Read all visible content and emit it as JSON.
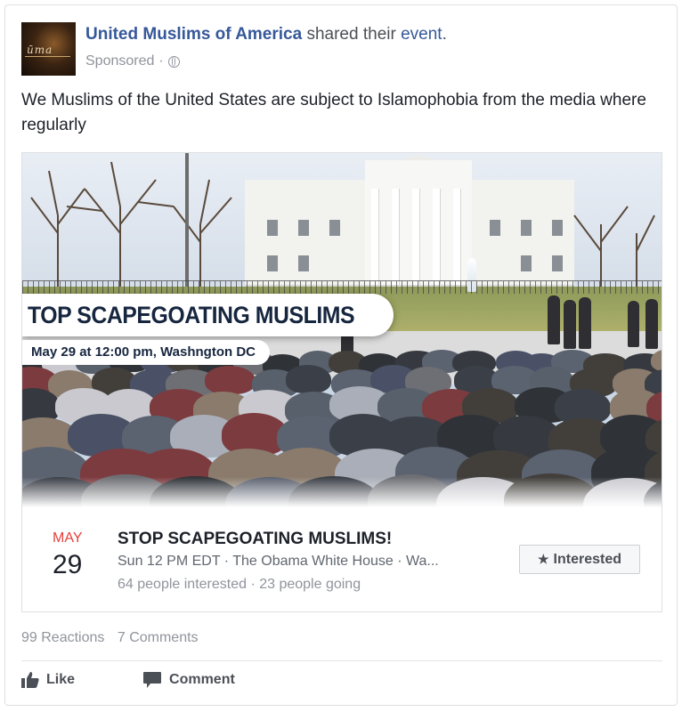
{
  "post": {
    "page_name": "United Muslims of America",
    "shared_prefix": "shared their",
    "shared_link": "event",
    "shared_suffix": ".",
    "sponsored": "Sponsored",
    "separator": "·",
    "privacy_icon": "globe-icon",
    "avatar_text": "ūma",
    "text": "We Muslims of the United States are subject to Islamophobia from the media where regularly"
  },
  "event_image": {
    "banner_title": "TOP SCAPEGOATING MUSLIMS",
    "banner_date": "May 29 at 12:00 pm, Washngton DC"
  },
  "event": {
    "month": "MAY",
    "day": "29",
    "title": "STOP SCAPEGOATING MUSLIMS!",
    "details": "Sun 12 PM EDT · The Obama White House · Wa...",
    "stats": "64 people interested · 23 people going",
    "interested_label": "Interested",
    "interested_icon": "star-icon"
  },
  "engagement": {
    "reactions": "99 Reactions",
    "comments": "7 Comments"
  },
  "actions": {
    "like_label": "Like",
    "comment_label": "Comment",
    "like_icon": "thumbs-up-icon",
    "comment_icon": "speech-bubble-icon"
  },
  "colors": {
    "link": "#365899",
    "month": "#e4403b",
    "banner_text": "#17263f"
  }
}
